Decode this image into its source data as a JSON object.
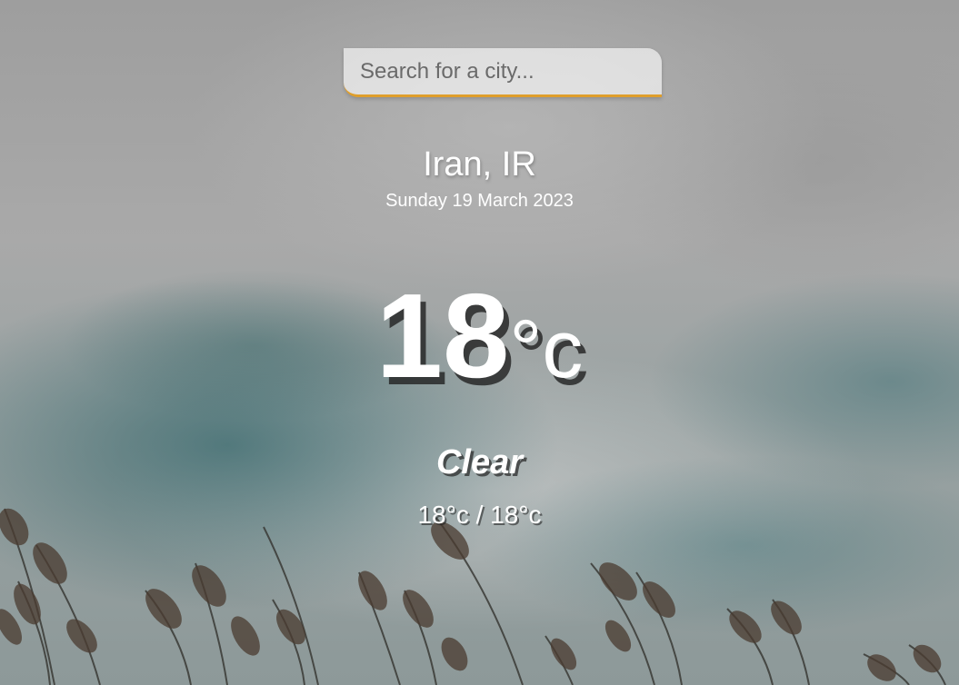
{
  "search": {
    "placeholder": "Search for a city...",
    "value": "",
    "accent_color": "#df9e2b"
  },
  "location": {
    "city": "Iran, IR",
    "date": "Sunday 19 March 2023"
  },
  "current": {
    "temp": "18",
    "unit": "°c",
    "weather": "Clear",
    "hi_low": "18°c / 18°c"
  },
  "background": {
    "description_color": "#9e9e9e"
  }
}
